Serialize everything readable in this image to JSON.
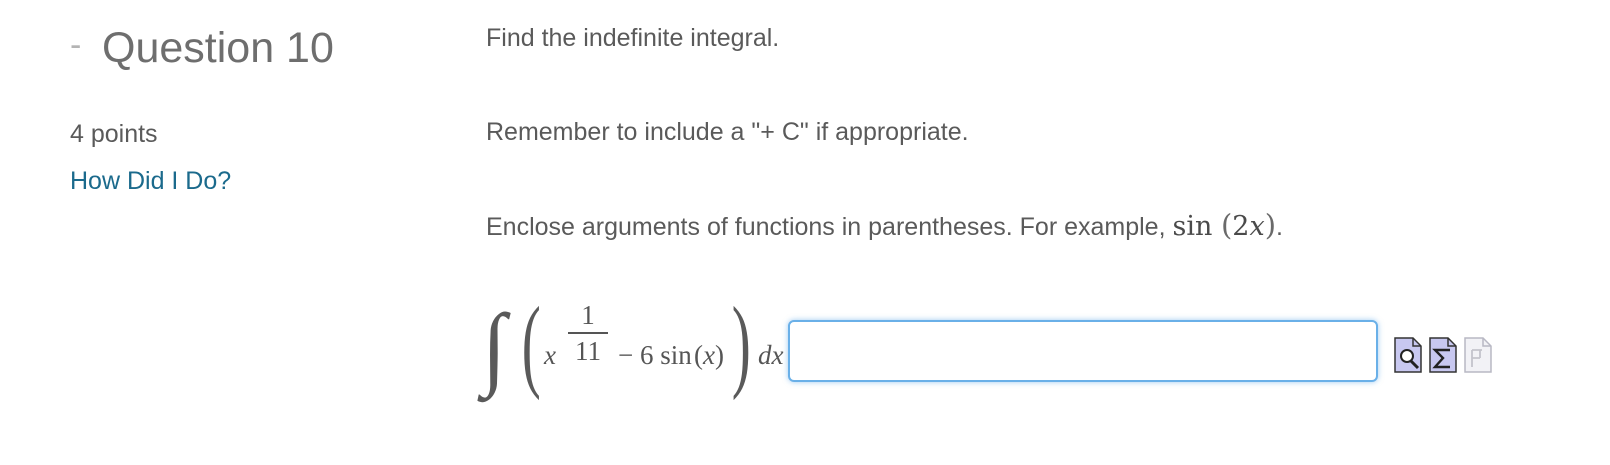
{
  "question": {
    "collapse_symbol": "-",
    "title": "Question 10",
    "points": "4 points",
    "how_did_i_do": "How Did I Do?"
  },
  "instructions": {
    "line1": "Find the indefinite integral.",
    "line2": "Remember to include a \"+ C\" if appropriate.",
    "line3_prefix": "Enclose arguments of functions in parentheses. For example, ",
    "line3_example_fn": "sin",
    "line3_example_arg_open": "(",
    "line3_example_arg": "2",
    "line3_example_var": "x",
    "line3_example_arg_close": ")",
    "line3_suffix": "."
  },
  "integral": {
    "sign": "∫",
    "paren_open": "(",
    "base_var": "x",
    "exp_num": "1",
    "exp_den": "11",
    "minus_term": "− 6 sin",
    "arg_open": "(",
    "arg_var": "x",
    "arg_close": ")",
    "paren_close": ")",
    "differential": "dx"
  },
  "answer": {
    "value": "",
    "placeholder": ""
  },
  "tools": {
    "preview_icon": "preview-magnifier-icon",
    "equation_editor_icon": "sigma-equation-icon",
    "pi_icon": "pi-icon-disabled"
  },
  "colors": {
    "link": "#1b6a8c",
    "input_border": "#6ab0e8",
    "text": "#5a5a5a",
    "title": "#6e6e6e"
  }
}
